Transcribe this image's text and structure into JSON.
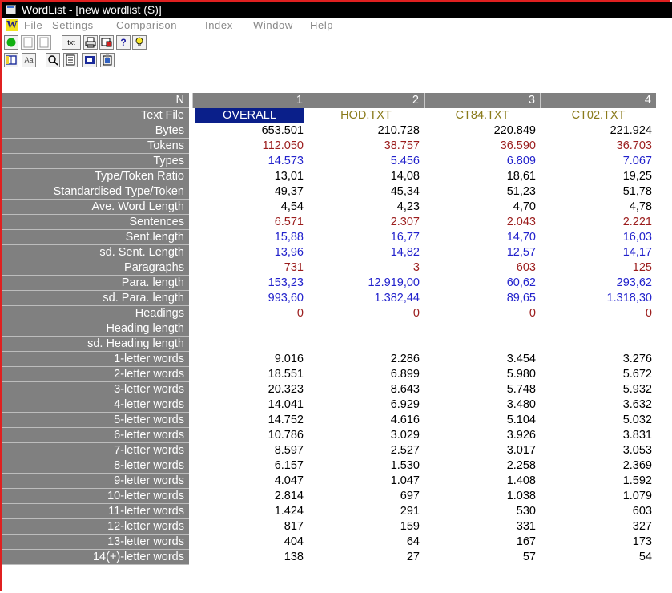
{
  "window": {
    "title": "WordList - [new wordlist (S)]",
    "app_logo": "W"
  },
  "menu": [
    "File",
    "Settings",
    "Comparison",
    "Index",
    "Window",
    "Help"
  ],
  "toolbar1": [
    "green-circle-icon",
    "blank-page-icon",
    "blank-page-icon",
    "txt",
    "printer-icon",
    "print-preview-icon",
    "?",
    "lightbulb-icon"
  ],
  "toolbar1_txt": "txt",
  "toolbar1_help": "?",
  "toolbar2": [
    "columns-icon",
    "Aa",
    "search-icon",
    "list-icon",
    "frame-icon",
    "clipboard-icon"
  ],
  "toolbar2_font": "Aa",
  "colors": {
    "black": "#000000",
    "red": "#9b1c1c",
    "blue": "#2222cc",
    "olive": "#8a7a1a",
    "selected": "#0a1f8a",
    "header": "#808080"
  },
  "table": {
    "n_label": "N",
    "columns": [
      "1",
      "2",
      "3",
      "4"
    ],
    "rows": [
      {
        "label": "Text File",
        "color": "olive",
        "values": [
          "OVERALL",
          "HOD.TXT",
          "CT84.TXT",
          "CT02.TXT"
        ]
      },
      {
        "label": "Bytes",
        "color": "black",
        "values": [
          "653.501",
          "210.728",
          "220.849",
          "221.924"
        ]
      },
      {
        "label": "Tokens",
        "color": "red",
        "values": [
          "112.050",
          "38.757",
          "36.590",
          "36.703"
        ]
      },
      {
        "label": "Types",
        "color": "blue",
        "values": [
          "14.573",
          "5.456",
          "6.809",
          "7.067"
        ]
      },
      {
        "label": "Type/Token Ratio",
        "color": "black",
        "values": [
          "13,01",
          "14,08",
          "18,61",
          "19,25"
        ]
      },
      {
        "label": "Standardised Type/Token",
        "color": "black",
        "values": [
          "49,37",
          "45,34",
          "51,23",
          "51,78"
        ]
      },
      {
        "label": "Ave. Word Length",
        "color": "black",
        "values": [
          "4,54",
          "4,23",
          "4,70",
          "4,78"
        ]
      },
      {
        "label": "Sentences",
        "color": "red",
        "values": [
          "6.571",
          "2.307",
          "2.043",
          "2.221"
        ]
      },
      {
        "label": "Sent.length",
        "color": "blue",
        "values": [
          "15,88",
          "16,77",
          "14,70",
          "16,03"
        ]
      },
      {
        "label": "sd. Sent. Length",
        "color": "blue",
        "values": [
          "13,96",
          "14,82",
          "12,57",
          "14,17"
        ]
      },
      {
        "label": "Paragraphs",
        "color": "red",
        "values": [
          "731",
          "3",
          "603",
          "125"
        ]
      },
      {
        "label": "Para. length",
        "color": "blue",
        "values": [
          "153,23",
          "12.919,00",
          "60,62",
          "293,62"
        ]
      },
      {
        "label": "sd. Para. length",
        "color": "blue",
        "values": [
          "993,60",
          "1.382,44",
          "89,65",
          "1.318,30"
        ]
      },
      {
        "label": "Headings",
        "color": "red",
        "values": [
          "0",
          "0",
          "0",
          "0"
        ]
      },
      {
        "label": "Heading length",
        "color": "blue",
        "values": [
          "",
          "",
          "",
          ""
        ]
      },
      {
        "label": "sd. Heading length",
        "color": "blue",
        "values": [
          "",
          "",
          "",
          ""
        ]
      },
      {
        "label": "1-letter words",
        "color": "black",
        "values": [
          "9.016",
          "2.286",
          "3.454",
          "3.276"
        ]
      },
      {
        "label": "2-letter words",
        "color": "black",
        "values": [
          "18.551",
          "6.899",
          "5.980",
          "5.672"
        ]
      },
      {
        "label": "3-letter words",
        "color": "black",
        "values": [
          "20.323",
          "8.643",
          "5.748",
          "5.932"
        ]
      },
      {
        "label": "4-letter words",
        "color": "black",
        "values": [
          "14.041",
          "6.929",
          "3.480",
          "3.632"
        ]
      },
      {
        "label": "5-letter words",
        "color": "black",
        "values": [
          "14.752",
          "4.616",
          "5.104",
          "5.032"
        ]
      },
      {
        "label": "6-letter words",
        "color": "black",
        "values": [
          "10.786",
          "3.029",
          "3.926",
          "3.831"
        ]
      },
      {
        "label": "7-letter words",
        "color": "black",
        "values": [
          "8.597",
          "2.527",
          "3.017",
          "3.053"
        ]
      },
      {
        "label": "8-letter words",
        "color": "black",
        "values": [
          "6.157",
          "1.530",
          "2.258",
          "2.369"
        ]
      },
      {
        "label": "9-letter words",
        "color": "black",
        "values": [
          "4.047",
          "1.047",
          "1.408",
          "1.592"
        ]
      },
      {
        "label": "10-letter words",
        "color": "black",
        "values": [
          "2.814",
          "697",
          "1.038",
          "1.079"
        ]
      },
      {
        "label": "11-letter words",
        "color": "black",
        "values": [
          "1.424",
          "291",
          "530",
          "603"
        ]
      },
      {
        "label": "12-letter words",
        "color": "black",
        "values": [
          "817",
          "159",
          "331",
          "327"
        ]
      },
      {
        "label": "13-letter words",
        "color": "black",
        "values": [
          "404",
          "64",
          "167",
          "173"
        ]
      },
      {
        "label": "14(+)-letter words",
        "color": "black",
        "values": [
          "138",
          "27",
          "57",
          "54"
        ]
      }
    ]
  }
}
